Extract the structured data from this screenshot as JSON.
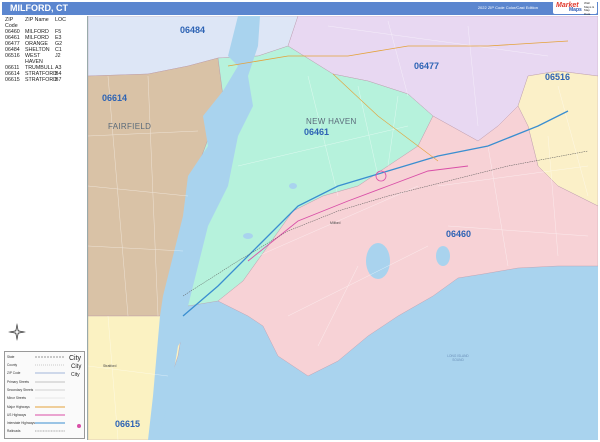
{
  "header": {
    "title": "MILFORD, CT",
    "edition": "2022 ZIP Code Color/Cast Edition",
    "logo_a": "Market",
    "logo_b": "Maps",
    "logo_c": "Wall Maps & Map Data"
  },
  "zip_table": {
    "headers": [
      "ZIP Code",
      "ZIP Name",
      "LOC"
    ],
    "rows": [
      [
        "06460",
        "MILFORD",
        "F5"
      ],
      [
        "06461",
        "MILFORD",
        "E3"
      ],
      [
        "06477",
        "ORANGE",
        "G2"
      ],
      [
        "06484",
        "SHELTON",
        "C1"
      ],
      [
        "06516",
        "WEST HAVEN",
        "J2"
      ],
      [
        "06611",
        "TRUMBULL",
        "A3"
      ],
      [
        "06614",
        "STRATFORD",
        "B4"
      ],
      [
        "06615",
        "STRATFORD",
        "B7"
      ]
    ]
  },
  "legend": {
    "rows": [
      "State",
      "County",
      "ZIP Code",
      "Primary Streets",
      "Secondary Streets",
      "Minor Streets",
      "Major Highways",
      "US Highways",
      "Interstate Highways",
      "Railroads"
    ],
    "cities": [
      "City",
      "City",
      "City"
    ]
  },
  "map": {
    "zip_labels": [
      {
        "id": "06484",
        "text": "06484"
      },
      {
        "id": "06477",
        "text": "06477"
      },
      {
        "id": "06516",
        "text": "06516"
      },
      {
        "id": "06614",
        "text": "06614"
      },
      {
        "id": "06461",
        "text": "06461"
      },
      {
        "id": "06460",
        "text": "06460"
      },
      {
        "id": "06615",
        "text": "06615"
      }
    ],
    "county_labels": {
      "fairfield": "FAIRFIELD",
      "new_haven": "NEW HAVEN"
    },
    "place_labels": {
      "milford": "Milford",
      "stratford": "Stratford"
    },
    "water_label": "LONG ISLAND SOUND",
    "colors": {
      "zip_06484": "#dde6f6",
      "zip_06477": "#e8d8f2",
      "zip_06516": "#fbf0c8",
      "zip_06614": "#d9c2a6",
      "zip_06461": "#b6f2dc",
      "zip_06460": "#f7d2d6",
      "zip_06615": "#fbf2c2",
      "water": "#a9d3ee"
    }
  }
}
